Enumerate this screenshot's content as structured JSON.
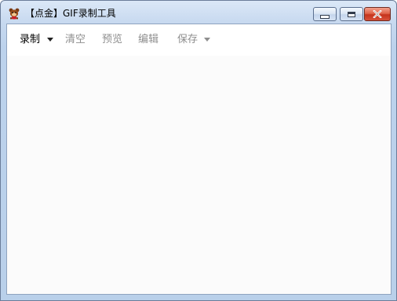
{
  "window": {
    "title": "【点金】GIF录制工具",
    "icon": "app-mascot-icon"
  },
  "caption_buttons": {
    "minimize_icon": "minimize-icon",
    "maximize_icon": "maximize-icon",
    "close_icon": "close-icon",
    "close_color": "#c5341c"
  },
  "toolbar": {
    "record_label": "录制",
    "clear_label": "清空",
    "preview_label": "预览",
    "edit_label": "编辑",
    "save_label": "保存",
    "enabled_color": "#000000",
    "disabled_color": "#8e8e8e"
  }
}
